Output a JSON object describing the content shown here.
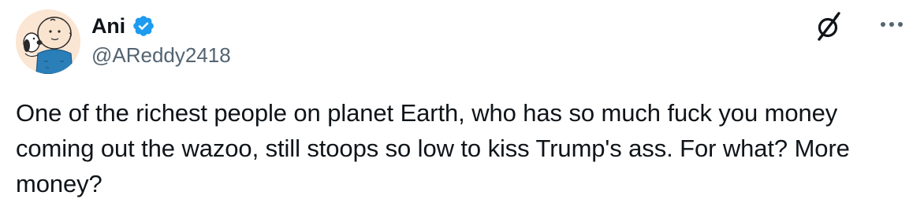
{
  "author": {
    "display_name": "Ani",
    "handle": "@AReddy2418",
    "verified": true,
    "avatar_icon": "snoopy-avatar-icon"
  },
  "actions": {
    "grok_icon": "grok-slash-icon",
    "more_icon": "more-dots-icon"
  },
  "tweet": {
    "text": "One of the richest people on planet Earth, who has so much fuck you money coming out the wazoo, still stoops so low to kiss Trump's ass. For what? More money?"
  },
  "colors": {
    "text": "#0f1419",
    "secondary": "#536471",
    "verified_blue": "#1d9bf0",
    "background": "#ffffff"
  }
}
